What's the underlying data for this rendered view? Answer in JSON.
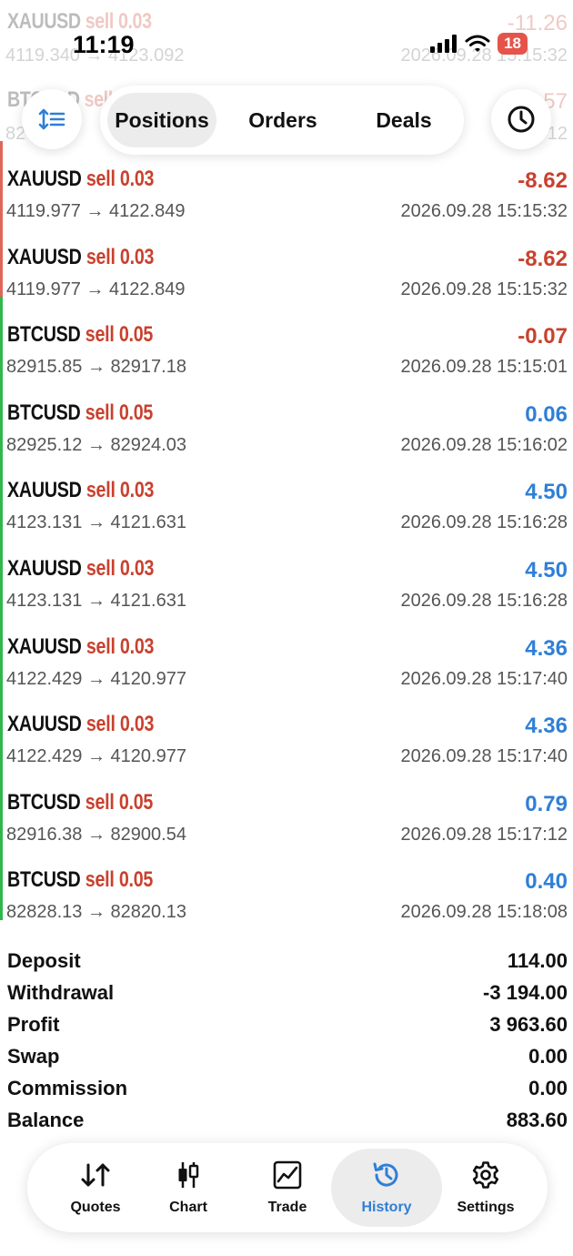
{
  "status_bar": {
    "time": "11:19",
    "battery": "18"
  },
  "ghost_rows": [
    {
      "symbol": "XAUUSD",
      "side": "sell 0.03",
      "prices": "4119.340 → 4123.092",
      "profit": "-11.26",
      "date": "2026.09.28 15:15:32"
    },
    {
      "symbol": "BTCUSD",
      "side": "sell",
      "prices": "82",
      "profit": "57",
      "date": "12"
    }
  ],
  "toolbar": {
    "tabs": [
      {
        "label": "Positions",
        "active": true
      },
      {
        "label": "Orders",
        "active": false
      },
      {
        "label": "Deals",
        "active": false
      }
    ],
    "sort_icon": "sort-icon",
    "history_icon": "clock-icon"
  },
  "colors": {
    "sell": "#c9412e",
    "profit_negative": "#c9412e",
    "profit_positive": "#2f7fd6",
    "bar_loss": "#e0665a",
    "bar_profit": "#2fb84a",
    "accent": "#2f7fd6"
  },
  "deals": [
    {
      "symbol": "XAUUSD",
      "side": "sell 0.03",
      "prices": "4119.977 → 4122.849",
      "profit": "-8.62",
      "date": "2026.09.28 15:15:32",
      "negative": true
    },
    {
      "symbol": "XAUUSD",
      "side": "sell 0.03",
      "prices": "4119.977 → 4122.849",
      "profit": "-8.62",
      "date": "2026.09.28 15:15:32",
      "negative": true
    },
    {
      "symbol": "BTCUSD",
      "side": "sell 0.05",
      "prices": "82915.85 → 82917.18",
      "profit": "-0.07",
      "date": "2026.09.28 15:15:01",
      "negative": true
    },
    {
      "symbol": "BTCUSD",
      "side": "sell 0.05",
      "prices": "82925.12 → 82924.03",
      "profit": "0.06",
      "date": "2026.09.28 15:16:02",
      "negative": false
    },
    {
      "symbol": "XAUUSD",
      "side": "sell 0.03",
      "prices": "4123.131 → 4121.631",
      "profit": "4.50",
      "date": "2026.09.28 15:16:28",
      "negative": false
    },
    {
      "symbol": "XAUUSD",
      "side": "sell 0.03",
      "prices": "4123.131 → 4121.631",
      "profit": "4.50",
      "date": "2026.09.28 15:16:28",
      "negative": false
    },
    {
      "symbol": "XAUUSD",
      "side": "sell 0.03",
      "prices": "4122.429 → 4120.977",
      "profit": "4.36",
      "date": "2026.09.28 15:17:40",
      "negative": false
    },
    {
      "symbol": "XAUUSD",
      "side": "sell 0.03",
      "prices": "4122.429 → 4120.977",
      "profit": "4.36",
      "date": "2026.09.28 15:17:40",
      "negative": false
    },
    {
      "symbol": "BTCUSD",
      "side": "sell 0.05",
      "prices": "82916.38 → 82900.54",
      "profit": "0.79",
      "date": "2026.09.28 15:17:12",
      "negative": false
    },
    {
      "symbol": "BTCUSD",
      "side": "sell 0.05",
      "prices": "82828.13 → 82820.13",
      "profit": "0.40",
      "date": "2026.09.28 15:18:08",
      "negative": false
    }
  ],
  "summary": [
    {
      "label": "Deposit",
      "value": "114.00"
    },
    {
      "label": "Withdrawal",
      "value": "-3 194.00"
    },
    {
      "label": "Profit",
      "value": "3 963.60"
    },
    {
      "label": "Swap",
      "value": "0.00"
    },
    {
      "label": "Commission",
      "value": "0.00"
    },
    {
      "label": "Balance",
      "value": "883.60"
    }
  ],
  "nav": [
    {
      "label": "Quotes",
      "icon": "quotes-arrows-icon",
      "active": false
    },
    {
      "label": "Chart",
      "icon": "candlestick-icon",
      "active": false
    },
    {
      "label": "Trade",
      "icon": "trade-chart-icon",
      "active": false
    },
    {
      "label": "History",
      "icon": "history-icon",
      "active": true
    },
    {
      "label": "Settings",
      "icon": "gear-icon",
      "active": false
    }
  ]
}
